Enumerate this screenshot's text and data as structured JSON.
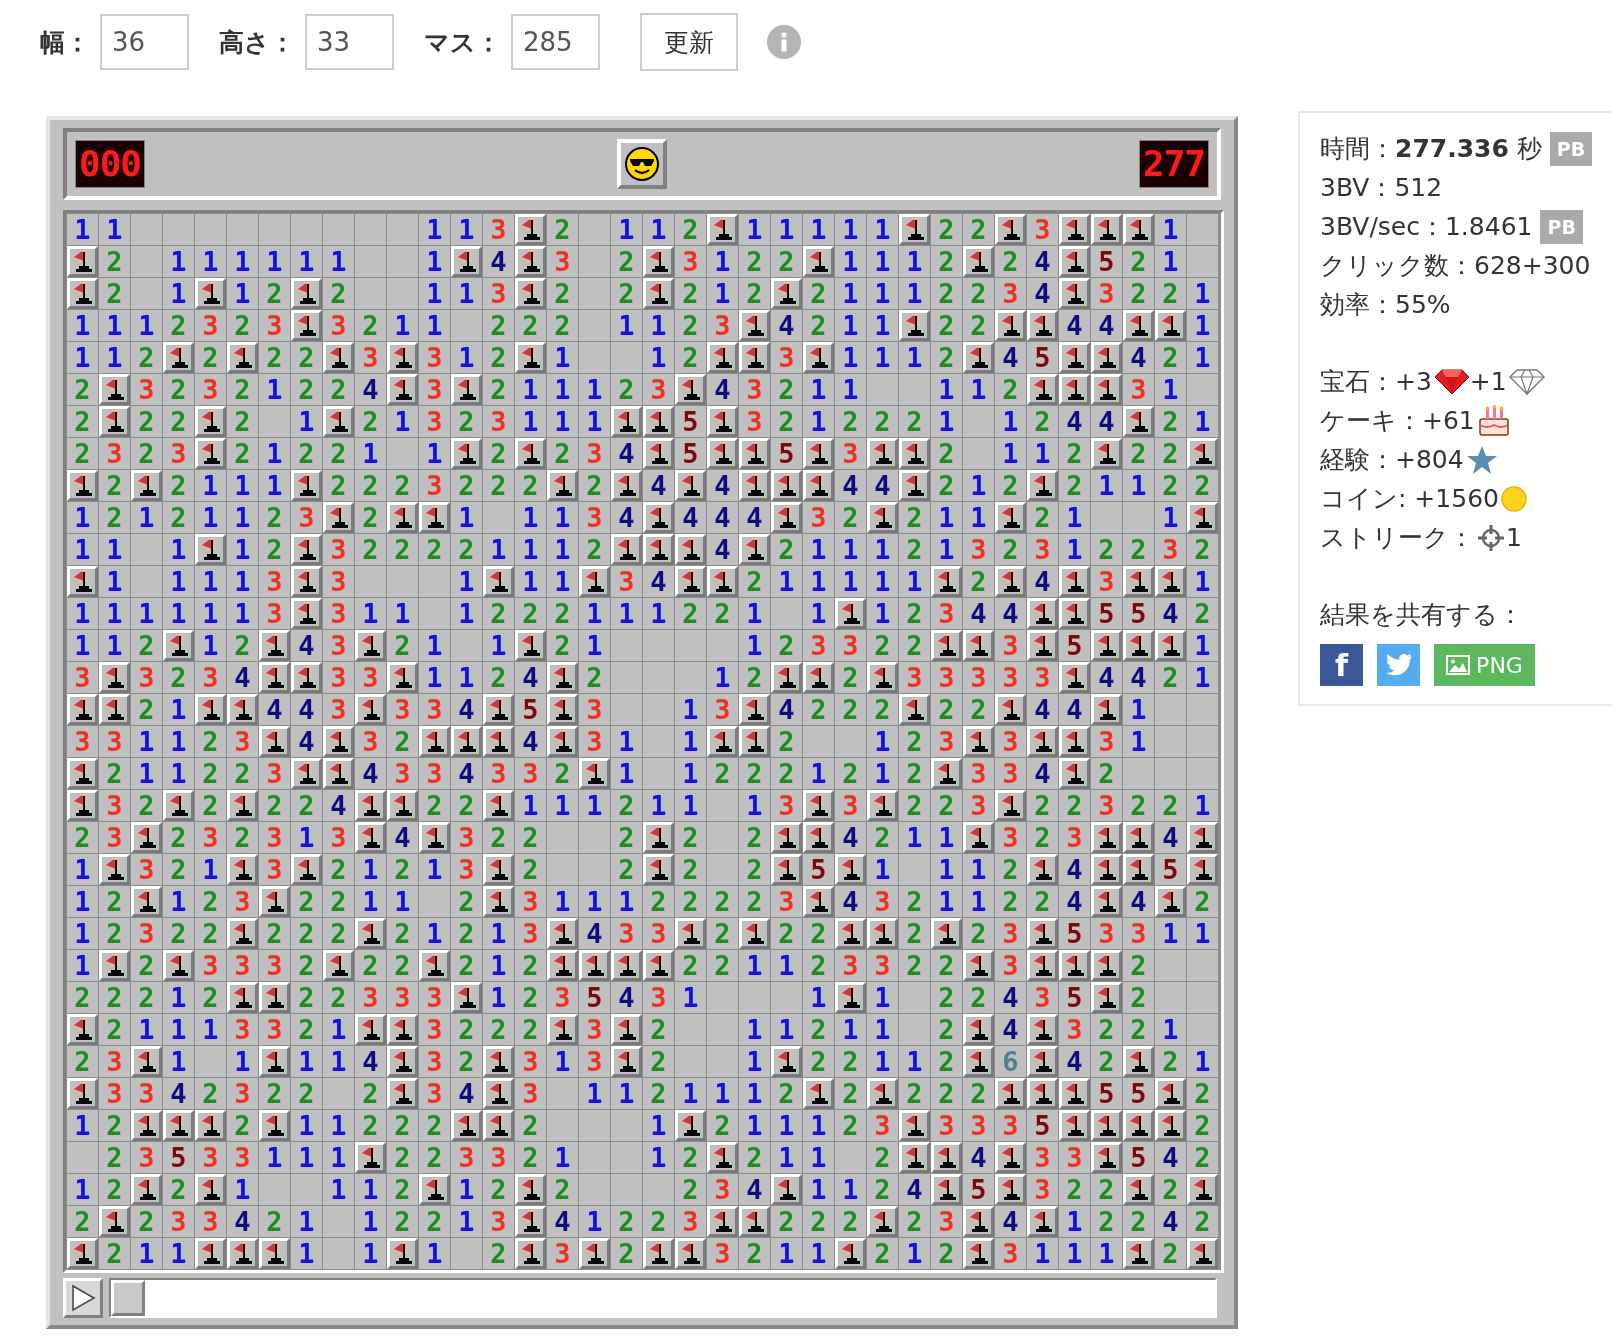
{
  "settings": {
    "fields": [
      {
        "label": "幅：",
        "value": "36"
      },
      {
        "label": "高さ：",
        "value": "33"
      },
      {
        "label": "マス：",
        "value": "285"
      }
    ],
    "update_button": "更新"
  },
  "game": {
    "mine_counter": "000",
    "timer": "277",
    "board": {
      "rows": [
        [
          "1",
          "1",
          null,
          null,
          null,
          null,
          null,
          null,
          null,
          null,
          null,
          "1",
          "1",
          "3",
          {
            "flagged": true
          },
          "2",
          null,
          "1",
          "1",
          "2",
          {
            "flagged": true
          },
          "1",
          "1",
          "1",
          "1",
          "1",
          {
            "flagged": true
          },
          "2",
          "2",
          {
            "flagged": true
          },
          "3",
          {
            "flagged": true
          },
          {
            "flagged": true
          },
          {
            "flagged": true
          },
          "1",
          null
        ],
        [
          {
            "flagged": true
          },
          "2",
          null,
          "1",
          "1",
          "1",
          "1",
          "1",
          "1",
          null,
          null,
          "1",
          {
            "flagged": true
          },
          "4",
          {
            "flagged": true
          },
          "3",
          null,
          "2",
          {
            "flagged": true
          },
          "3",
          "1",
          "2",
          "2",
          {
            "flagged": true
          },
          "1",
          "1",
          "1",
          "2",
          {
            "flagged": true
          },
          "2",
          "4",
          {
            "flagged": true
          },
          "5",
          "2",
          "1",
          null
        ],
        [
          {
            "flagged": true
          },
          "2",
          null,
          "1",
          {
            "flagged": true
          },
          "1",
          "2",
          {
            "flagged": true
          },
          "2",
          null,
          null,
          "1",
          "1",
          "3",
          {
            "flagged": true
          },
          "2",
          null,
          "2",
          {
            "flagged": true
          },
          "2",
          "1",
          "2",
          {
            "flagged": true
          },
          "2",
          "1",
          "1",
          "1",
          "2",
          "2",
          "3",
          "4",
          {
            "flagged": true
          },
          "3",
          "2",
          "2",
          "1"
        ],
        [
          "1",
          "1",
          "1",
          "2",
          "3",
          "2",
          "3",
          {
            "flagged": true
          },
          "3",
          "2",
          "1",
          "1",
          null,
          "2",
          "2",
          "2",
          null,
          "1",
          "1",
          "2",
          "3",
          {
            "flagged": true
          },
          "4",
          "2",
          "1",
          "1",
          {
            "flagged": true
          },
          "2",
          "2",
          {
            "flagged": true
          },
          {
            "flagged": true
          },
          "4",
          "4",
          {
            "flagged": true
          },
          {
            "flagged": true
          },
          "1"
        ],
        [
          "1",
          "1",
          "2",
          {
            "flagged": true
          },
          "2",
          {
            "flagged": true
          },
          "2",
          "2",
          {
            "flagged": true
          },
          "3",
          {
            "flagged": true
          },
          "3",
          "1",
          "2",
          {
            "flagged": true
          },
          "1",
          null,
          null,
          "1",
          "2",
          {
            "flagged": true
          },
          {
            "flagged": true
          },
          "3",
          {
            "flagged": true
          },
          "1",
          "1",
          "1",
          "2",
          {
            "flagged": true
          },
          "4",
          "5",
          {
            "flagged": true
          },
          {
            "flagged": true
          },
          "4",
          "2",
          "1"
        ],
        [
          "2",
          {
            "flagged": true
          },
          "3",
          "2",
          "3",
          "2",
          "1",
          "2",
          "2",
          "4",
          {
            "flagged": true
          },
          "3",
          {
            "flagged": true
          },
          "2",
          "1",
          "1",
          "1",
          "2",
          "3",
          {
            "flagged": true
          },
          "4",
          "3",
          "2",
          "1",
          "1",
          null,
          null,
          "1",
          "1",
          "2",
          {
            "flagged": true
          },
          {
            "flagged": true
          },
          {
            "flagged": true
          },
          "3",
          "1",
          null
        ],
        [
          "2",
          {
            "flagged": true
          },
          "2",
          "2",
          {
            "flagged": true
          },
          "2",
          null,
          "1",
          {
            "flagged": true
          },
          "2",
          "1",
          "3",
          "2",
          "3",
          "1",
          "1",
          "1",
          {
            "flagged": true
          },
          {
            "flagged": true
          },
          "5",
          {
            "flagged": true
          },
          "3",
          "2",
          "1",
          "2",
          "2",
          "2",
          "1",
          null,
          "1",
          "2",
          "4",
          "4",
          {
            "flagged": true
          },
          "2",
          "1"
        ],
        [
          "2",
          "3",
          "2",
          "3",
          {
            "flagged": true
          },
          "2",
          "1",
          "2",
          "2",
          "1",
          null,
          "1",
          {
            "flagged": true
          },
          "2",
          {
            "flagged": true
          },
          "2",
          "3",
          "4",
          {
            "flagged": true
          },
          "5",
          {
            "flagged": true
          },
          {
            "flagged": true
          },
          "5",
          {
            "flagged": true
          },
          "3",
          {
            "flagged": true
          },
          {
            "flagged": true
          },
          "2",
          null,
          "1",
          "1",
          "2",
          {
            "flagged": true
          },
          "2",
          "2",
          {
            "flagged": true
          }
        ],
        [
          {
            "flagged": true
          },
          "2",
          {
            "flagged": true
          },
          "2",
          "1",
          "1",
          "1",
          {
            "flagged": true
          },
          "2",
          "2",
          "2",
          "3",
          "2",
          "2",
          "2",
          {
            "flagged": true
          },
          "2",
          {
            "flagged": true
          },
          "4",
          {
            "flagged": true
          },
          "4",
          {
            "flagged": true
          },
          {
            "flagged": true
          },
          {
            "flagged": true
          },
          "4",
          "4",
          {
            "flagged": true
          },
          "2",
          "1",
          "2",
          {
            "flagged": true
          },
          "2",
          "1",
          "1",
          "2",
          "2"
        ],
        [
          "1",
          "2",
          "1",
          "2",
          "1",
          "1",
          "2",
          "3",
          {
            "flagged": true
          },
          "2",
          {
            "flagged": true
          },
          {
            "flagged": true
          },
          "1",
          null,
          "1",
          "1",
          "3",
          "4",
          {
            "flagged": true
          },
          "4",
          "4",
          "4",
          {
            "flagged": true
          },
          "3",
          "2",
          {
            "flagged": true
          },
          "2",
          "1",
          "1",
          {
            "flagged": true
          },
          "2",
          "1",
          null,
          null,
          "1",
          {
            "flagged": true
          }
        ],
        [
          "1",
          "1",
          null,
          "1",
          {
            "flagged": true
          },
          "1",
          "2",
          {
            "flagged": true
          },
          "3",
          "2",
          "2",
          "2",
          "2",
          "1",
          "1",
          "1",
          "2",
          {
            "flagged": true
          },
          {
            "flagged": true
          },
          {
            "flagged": true
          },
          "4",
          {
            "flagged": true
          },
          "2",
          "1",
          "1",
          "1",
          "2",
          "1",
          "3",
          "2",
          "3",
          "1",
          "2",
          "2",
          "3",
          "2"
        ],
        [
          {
            "flagged": true
          },
          "1",
          null,
          "1",
          "1",
          "1",
          "3",
          {
            "flagged": true
          },
          "3",
          null,
          null,
          null,
          "1",
          {
            "flagged": true
          },
          "1",
          "1",
          {
            "flagged": true
          },
          "3",
          "4",
          {
            "flagged": true
          },
          {
            "flagged": true
          },
          "2",
          "1",
          "1",
          "1",
          "1",
          "1",
          {
            "flagged": true
          },
          "2",
          {
            "flagged": true
          },
          "4",
          {
            "flagged": true
          },
          "3",
          {
            "flagged": true
          },
          {
            "flagged": true
          },
          "1"
        ],
        [
          "1",
          "1",
          "1",
          "1",
          "1",
          "1",
          "3",
          {
            "flagged": true
          },
          "3",
          "1",
          "1",
          null,
          "1",
          "2",
          "2",
          "2",
          "1",
          "1",
          "1",
          "2",
          "2",
          "1",
          null,
          "1",
          {
            "flagged": true
          },
          "1",
          "2",
          "3",
          "4",
          "4",
          {
            "flagged": true
          },
          {
            "flagged": true
          },
          "5",
          "5",
          "4",
          "2"
        ],
        [
          "1",
          "1",
          "2",
          {
            "flagged": true
          },
          "1",
          "2",
          {
            "flagged": true
          },
          "4",
          "3",
          {
            "flagged": true
          },
          "2",
          "1",
          null,
          "1",
          {
            "flagged": true
          },
          "2",
          "1",
          null,
          null,
          null,
          null,
          "1",
          "2",
          "3",
          "3",
          "2",
          "2",
          {
            "flagged": true
          },
          {
            "flagged": true
          },
          "3",
          {
            "flagged": true
          },
          "5",
          {
            "flagged": true
          },
          {
            "flagged": true
          },
          {
            "flagged": true
          },
          "1"
        ],
        [
          "3",
          {
            "flagged": true
          },
          "3",
          "2",
          "3",
          "4",
          {
            "flagged": true
          },
          {
            "flagged": true
          },
          "3",
          "3",
          {
            "flagged": true
          },
          "1",
          "1",
          "2",
          "4",
          {
            "flagged": true
          },
          "2",
          null,
          null,
          null,
          "1",
          "2",
          {
            "flagged": true
          },
          {
            "flagged": true
          },
          "2",
          {
            "flagged": true
          },
          "3",
          "3",
          "3",
          "3",
          "3",
          {
            "flagged": true
          },
          "4",
          "4",
          "2",
          "1"
        ],
        [
          {
            "flagged": true
          },
          {
            "flagged": true
          },
          "2",
          "1",
          {
            "flagged": true
          },
          {
            "flagged": true
          },
          "4",
          "4",
          "3",
          {
            "flagged": true
          },
          "3",
          "3",
          "4",
          {
            "flagged": true
          },
          "5",
          {
            "flagged": true
          },
          "3",
          null,
          null,
          "1",
          "3",
          {
            "flagged": true
          },
          "4",
          "2",
          "2",
          "2",
          {
            "flagged": true
          },
          "2",
          "2",
          {
            "flagged": true
          },
          "4",
          "4",
          {
            "flagged": true
          },
          "1",
          null,
          null
        ],
        [
          "3",
          "3",
          "1",
          "1",
          "2",
          "3",
          {
            "flagged": true
          },
          "4",
          {
            "flagged": true
          },
          "3",
          "2",
          {
            "flagged": true
          },
          {
            "flagged": true
          },
          {
            "flagged": true
          },
          "4",
          {
            "flagged": true
          },
          "3",
          "1",
          null,
          "1",
          {
            "flagged": true
          },
          {
            "flagged": true
          },
          "2",
          null,
          null,
          "1",
          "2",
          "3",
          {
            "flagged": true
          },
          "3",
          {
            "flagged": true
          },
          {
            "flagged": true
          },
          "3",
          "1",
          null,
          null
        ],
        [
          {
            "flagged": true
          },
          "2",
          "1",
          "1",
          "2",
          "2",
          "3",
          {
            "flagged": true
          },
          {
            "flagged": true
          },
          "4",
          "3",
          "3",
          "4",
          "3",
          "3",
          "2",
          {
            "flagged": true
          },
          "1",
          null,
          "1",
          "2",
          "2",
          "2",
          "1",
          "2",
          "1",
          "2",
          {
            "flagged": true
          },
          "3",
          "3",
          "4",
          {
            "flagged": true
          },
          "2",
          null,
          null,
          null
        ],
        [
          {
            "flagged": true
          },
          "3",
          "2",
          {
            "flagged": true
          },
          "2",
          {
            "flagged": true
          },
          "2",
          "2",
          "4",
          {
            "flagged": true
          },
          {
            "flagged": true
          },
          "2",
          "2",
          {
            "flagged": true
          },
          "1",
          "1",
          "1",
          "2",
          "1",
          "1",
          null,
          "1",
          "3",
          {
            "flagged": true
          },
          "3",
          {
            "flagged": true
          },
          "2",
          "2",
          "3",
          {
            "flagged": true
          },
          "2",
          "2",
          "3",
          "2",
          "2",
          "1"
        ],
        [
          "2",
          "3",
          {
            "flagged": true
          },
          "2",
          "3",
          "2",
          "3",
          "1",
          "3",
          {
            "flagged": true
          },
          "4",
          {
            "flagged": true
          },
          "3",
          "2",
          "2",
          null,
          null,
          "2",
          {
            "flagged": true
          },
          "2",
          null,
          "2",
          {
            "flagged": true
          },
          {
            "flagged": true
          },
          "4",
          "2",
          "1",
          "1",
          {
            "flagged": true
          },
          "3",
          "2",
          "3",
          {
            "flagged": true
          },
          {
            "flagged": true
          },
          "4",
          {
            "flagged": true
          }
        ],
        [
          "1",
          {
            "flagged": true
          },
          "3",
          "2",
          "1",
          {
            "flagged": true
          },
          "3",
          {
            "flagged": true
          },
          "2",
          "1",
          "2",
          "1",
          "3",
          {
            "flagged": true
          },
          "2",
          null,
          null,
          "2",
          {
            "flagged": true
          },
          "2",
          null,
          "2",
          {
            "flagged": true
          },
          "5",
          {
            "flagged": true
          },
          "1",
          null,
          "1",
          "1",
          "2",
          {
            "flagged": true
          },
          "4",
          {
            "flagged": true
          },
          {
            "flagged": true
          },
          "5",
          {
            "flagged": true
          }
        ],
        [
          "1",
          "2",
          {
            "flagged": true
          },
          "1",
          "2",
          "3",
          {
            "flagged": true
          },
          "2",
          "2",
          "1",
          "1",
          null,
          "2",
          {
            "flagged": true
          },
          "3",
          "1",
          "1",
          "1",
          "2",
          "2",
          "2",
          "2",
          "3",
          {
            "flagged": true
          },
          "4",
          "3",
          "2",
          "1",
          "1",
          "2",
          "2",
          "4",
          {
            "flagged": true
          },
          "4",
          {
            "flagged": true
          },
          "2"
        ],
        [
          "1",
          "2",
          "3",
          "2",
          "2",
          {
            "flagged": true
          },
          "2",
          "2",
          "2",
          {
            "flagged": true
          },
          "2",
          "1",
          "2",
          "1",
          "3",
          {
            "flagged": true
          },
          "4",
          "3",
          "3",
          {
            "flagged": true
          },
          "2",
          {
            "flagged": true
          },
          "2",
          "2",
          {
            "flagged": true
          },
          {
            "flagged": true
          },
          "2",
          {
            "flagged": true
          },
          "2",
          "3",
          {
            "flagged": true
          },
          "5",
          "3",
          "3",
          "1",
          "1"
        ],
        [
          "1",
          {
            "flagged": true
          },
          "2",
          {
            "flagged": true
          },
          "3",
          "3",
          "3",
          "2",
          {
            "flagged": true
          },
          "2",
          "2",
          {
            "flagged": true
          },
          "2",
          "1",
          "2",
          {
            "flagged": true
          },
          {
            "flagged": true
          },
          {
            "flagged": true
          },
          {
            "flagged": true
          },
          "2",
          "2",
          "1",
          "1",
          "2",
          "3",
          "3",
          "2",
          "2",
          {
            "flagged": true
          },
          "3",
          {
            "flagged": true
          },
          {
            "flagged": true
          },
          {
            "flagged": true
          },
          "2",
          null,
          null
        ],
        [
          "2",
          "2",
          "2",
          "1",
          "2",
          {
            "flagged": true
          },
          {
            "flagged": true
          },
          "2",
          "2",
          "3",
          "3",
          "3",
          {
            "flagged": true
          },
          "1",
          "2",
          "3",
          "5",
          "4",
          "3",
          "1",
          null,
          null,
          null,
          "1",
          {
            "flagged": true
          },
          "1",
          null,
          "2",
          "2",
          "4",
          "3",
          "5",
          {
            "flagged": true
          },
          "2",
          null,
          null
        ],
        [
          {
            "flagged": true
          },
          "2",
          "1",
          "1",
          "1",
          "3",
          "3",
          "2",
          "1",
          {
            "flagged": true
          },
          {
            "flagged": true
          },
          "3",
          "2",
          "2",
          "2",
          {
            "flagged": true
          },
          "3",
          {
            "flagged": true
          },
          "2",
          null,
          null,
          "1",
          "1",
          "2",
          "1",
          "1",
          null,
          "2",
          {
            "flagged": true
          },
          "4",
          {
            "flagged": true
          },
          "3",
          "2",
          "2",
          "1",
          null
        ],
        [
          "2",
          "3",
          {
            "flagged": true
          },
          "1",
          null,
          "1",
          {
            "flagged": true
          },
          "1",
          "1",
          "4",
          {
            "flagged": true
          },
          "3",
          "2",
          {
            "flagged": true
          },
          "3",
          "1",
          "3",
          {
            "flagged": true
          },
          "2",
          null,
          null,
          "1",
          {
            "flagged": true
          },
          "2",
          "2",
          "1",
          "1",
          "2",
          {
            "flagged": true
          },
          "6",
          {
            "flagged": true
          },
          "4",
          "2",
          {
            "flagged": true
          },
          "2",
          "1"
        ],
        [
          {
            "flagged": true
          },
          "3",
          "3",
          "4",
          "2",
          "3",
          "2",
          "2",
          null,
          "2",
          {
            "flagged": true
          },
          "3",
          "4",
          {
            "flagged": true
          },
          "3",
          null,
          "1",
          "1",
          "2",
          "1",
          "1",
          "1",
          "2",
          {
            "flagged": true
          },
          "2",
          {
            "flagged": true
          },
          "2",
          "2",
          "2",
          {
            "flagged": true
          },
          {
            "flagged": true
          },
          {
            "flagged": true
          },
          "5",
          "5",
          {
            "flagged": true
          },
          "2"
        ],
        [
          "1",
          "2",
          {
            "flagged": true
          },
          {
            "flagged": true
          },
          {
            "flagged": true
          },
          "2",
          {
            "flagged": true
          },
          "1",
          "1",
          "2",
          "2",
          "2",
          {
            "flagged": true
          },
          {
            "flagged": true
          },
          "2",
          null,
          null,
          null,
          "1",
          {
            "flagged": true
          },
          "2",
          "1",
          "1",
          "1",
          "2",
          "3",
          {
            "flagged": true
          },
          "3",
          "3",
          "3",
          "5",
          {
            "flagged": true
          },
          {
            "flagged": true
          },
          {
            "flagged": true
          },
          {
            "flagged": true
          },
          "2"
        ],
        [
          null,
          "2",
          "3",
          "5",
          "3",
          "3",
          "1",
          "1",
          "1",
          {
            "flagged": true
          },
          "2",
          "2",
          "3",
          "3",
          "2",
          "1",
          null,
          null,
          "1",
          "2",
          {
            "flagged": true
          },
          "2",
          "1",
          "1",
          null,
          "2",
          {
            "flagged": true
          },
          {
            "flagged": true
          },
          "4",
          {
            "flagged": true
          },
          "3",
          "3",
          {
            "flagged": true
          },
          "5",
          "4",
          "2"
        ],
        [
          "1",
          "2",
          {
            "flagged": true
          },
          "2",
          {
            "flagged": true
          },
          "1",
          null,
          null,
          "1",
          "1",
          "2",
          {
            "flagged": true
          },
          "1",
          "2",
          {
            "flagged": true
          },
          "2",
          null,
          null,
          null,
          "2",
          "3",
          "4",
          {
            "flagged": true
          },
          "1",
          "1",
          "2",
          "4",
          {
            "flagged": true
          },
          "5",
          {
            "flagged": true
          },
          "3",
          "2",
          "2",
          {
            "flagged": true
          },
          "2",
          {
            "flagged": true
          }
        ],
        [
          "2",
          {
            "flagged": true
          },
          "2",
          "3",
          "3",
          "4",
          "2",
          "1",
          null,
          "1",
          "2",
          "2",
          "1",
          "3",
          {
            "flagged": true
          },
          "4",
          "1",
          "2",
          "2",
          "3",
          {
            "flagged": true
          },
          {
            "flagged": true
          },
          "2",
          "2",
          "2",
          {
            "flagged": true
          },
          "2",
          "3",
          {
            "flagged": true
          },
          "4",
          {
            "flagged": true
          },
          "1",
          "2",
          "2",
          "4",
          "2"
        ],
        [
          {
            "flagged": true
          },
          "2",
          "1",
          "1",
          {
            "flagged": true
          },
          {
            "flagged": true
          },
          {
            "flagged": true
          },
          "1",
          null,
          "1",
          {
            "flagged": true
          },
          "1",
          null,
          "2",
          {
            "flagged": true
          },
          "3",
          {
            "flagged": true
          },
          "2",
          {
            "flagged": true
          },
          {
            "flagged": true
          },
          "3",
          "2",
          "1",
          "1",
          {
            "flagged": true
          },
          "2",
          "1",
          "2",
          {
            "flagged": true
          },
          "3",
          "1",
          "1",
          "1",
          {
            "flagged": true
          },
          "2",
          {
            "flagged": true
          }
        ]
      ]
    },
    "replay": {
      "level": 0
    }
  },
  "stats": {
    "lines": [
      {
        "text": "時間：**277.336** 秒",
        "badge": "PB"
      },
      {
        "text": "3BV：512"
      },
      {
        "text": "3BV/sec：1.8461",
        "badge": "PB"
      },
      {
        "text": "クリック数：628+300"
      },
      {
        "text": "効率：55%"
      }
    ],
    "rewards": [
      {
        "parts": [
          {
            "kind": "text",
            "text": "宝石：+3"
          },
          {
            "kind": "ruby"
          },
          {
            "kind": "text",
            "text": "+1"
          },
          {
            "kind": "diamond"
          }
        ]
      },
      {
        "parts": [
          {
            "kind": "text",
            "text": "ケーキ：+61"
          },
          {
            "kind": "cake"
          }
        ]
      },
      {
        "parts": [
          {
            "kind": "text",
            "text": "経験：+804"
          },
          {
            "kind": "star"
          }
        ]
      },
      {
        "parts": [
          {
            "kind": "text",
            "text": "コイン: +1560"
          },
          {
            "kind": "coin"
          }
        ]
      },
      {
        "parts": [
          {
            "kind": "text",
            "text": "ストリーク："
          },
          {
            "kind": "crosshair"
          },
          {
            "kind": "text",
            "text": "1"
          }
        ]
      }
    ],
    "share": {
      "title": "結果を共有する：",
      "buttons": [
        {
          "kind": "facebook",
          "text": "f"
        },
        {
          "kind": "twitter"
        },
        {
          "kind": "png",
          "text": "PNG"
        }
      ]
    }
  }
}
